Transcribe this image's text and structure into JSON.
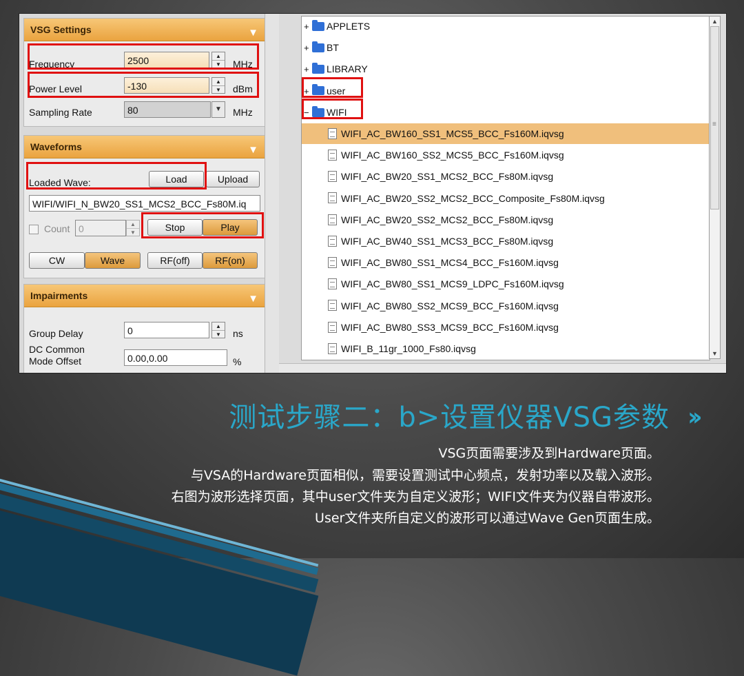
{
  "vsg_settings": {
    "header": "VSG Settings",
    "frequency_label": "Frequency",
    "frequency_value": "2500",
    "frequency_unit": "MHz",
    "power_label": "Power Level",
    "power_value": "-130",
    "power_unit": "dBm",
    "sampling_label": "Sampling Rate",
    "sampling_value": "80",
    "sampling_unit": "MHz"
  },
  "waveforms": {
    "header": "Waveforms",
    "loaded_label": "Loaded Wave:",
    "load_button": "Load",
    "upload_button": "Upload",
    "wave_path": "WIFI/WIFI_N_BW20_SS1_MCS2_BCC_Fs80M.iq",
    "count_label": "Count",
    "count_value": "0",
    "stop_button": "Stop",
    "play_button": "Play",
    "cw_button": "CW",
    "wave_button": "Wave",
    "rf_off_button": "RF(off)",
    "rf_on_button": "RF(on)"
  },
  "impairments": {
    "header": "Impairments",
    "group_delay_label": "Group Delay",
    "group_delay_value": "0",
    "group_delay_unit": "ns",
    "dc_label_1": "DC Common",
    "dc_label_2": "Mode Offset",
    "dc_value": "0.00,0.00",
    "dc_unit": "%"
  },
  "tree": {
    "folders": [
      {
        "sign": "+",
        "name": "APPLETS"
      },
      {
        "sign": "+",
        "name": "BT"
      },
      {
        "sign": "+",
        "name": "LIBRARY"
      },
      {
        "sign": "+",
        "name": "user"
      },
      {
        "sign": "−",
        "name": "WIFI"
      }
    ],
    "files": [
      "WIFI_AC_BW160_SS1_MCS5_BCC_Fs160M.iqvsg",
      "WIFI_AC_BW160_SS2_MCS5_BCC_Fs160M.iqvsg",
      "WIFI_AC_BW20_SS1_MCS2_BCC_Fs80M.iqvsg",
      "WIFI_AC_BW20_SS2_MCS2_BCC_Composite_Fs80M.iqvsg",
      "WIFI_AC_BW20_SS2_MCS2_BCC_Fs80M.iqvsg",
      "WIFI_AC_BW40_SS1_MCS3_BCC_Fs80M.iqvsg",
      "WIFI_AC_BW80_SS1_MCS4_BCC_Fs160M.iqvsg",
      "WIFI_AC_BW80_SS1_MCS9_LDPC_Fs160M.iqvsg",
      "WIFI_AC_BW80_SS2_MCS9_BCC_Fs160M.iqvsg",
      "WIFI_AC_BW80_SS3_MCS9_BCC_Fs160M.iqvsg",
      "WIFI_B_11gr_1000_Fs80.iqvsg"
    ],
    "selected_index": 0
  },
  "slide": {
    "title": "测试步骤二：b>设置仪器VSG参数",
    "chevron": "››",
    "lines": [
      "VSG页面需要涉及到Hardware页面。",
      "与VSA的Hardware页面相似，需要设置测试中心频点，发射功率以及载入波形。",
      "右图为波形选择页面，其中user文件夹为自定义波形；WIFI文件夹为仪器自带波形。",
      "User文件夹所自定义的波形可以通过Wave Gen页面生成。"
    ]
  },
  "colors": {
    "title": "#2aa7c9",
    "section_header": "#eaa33f",
    "highlight_box": "#e01010",
    "selected_row": "#f0bf7c"
  }
}
